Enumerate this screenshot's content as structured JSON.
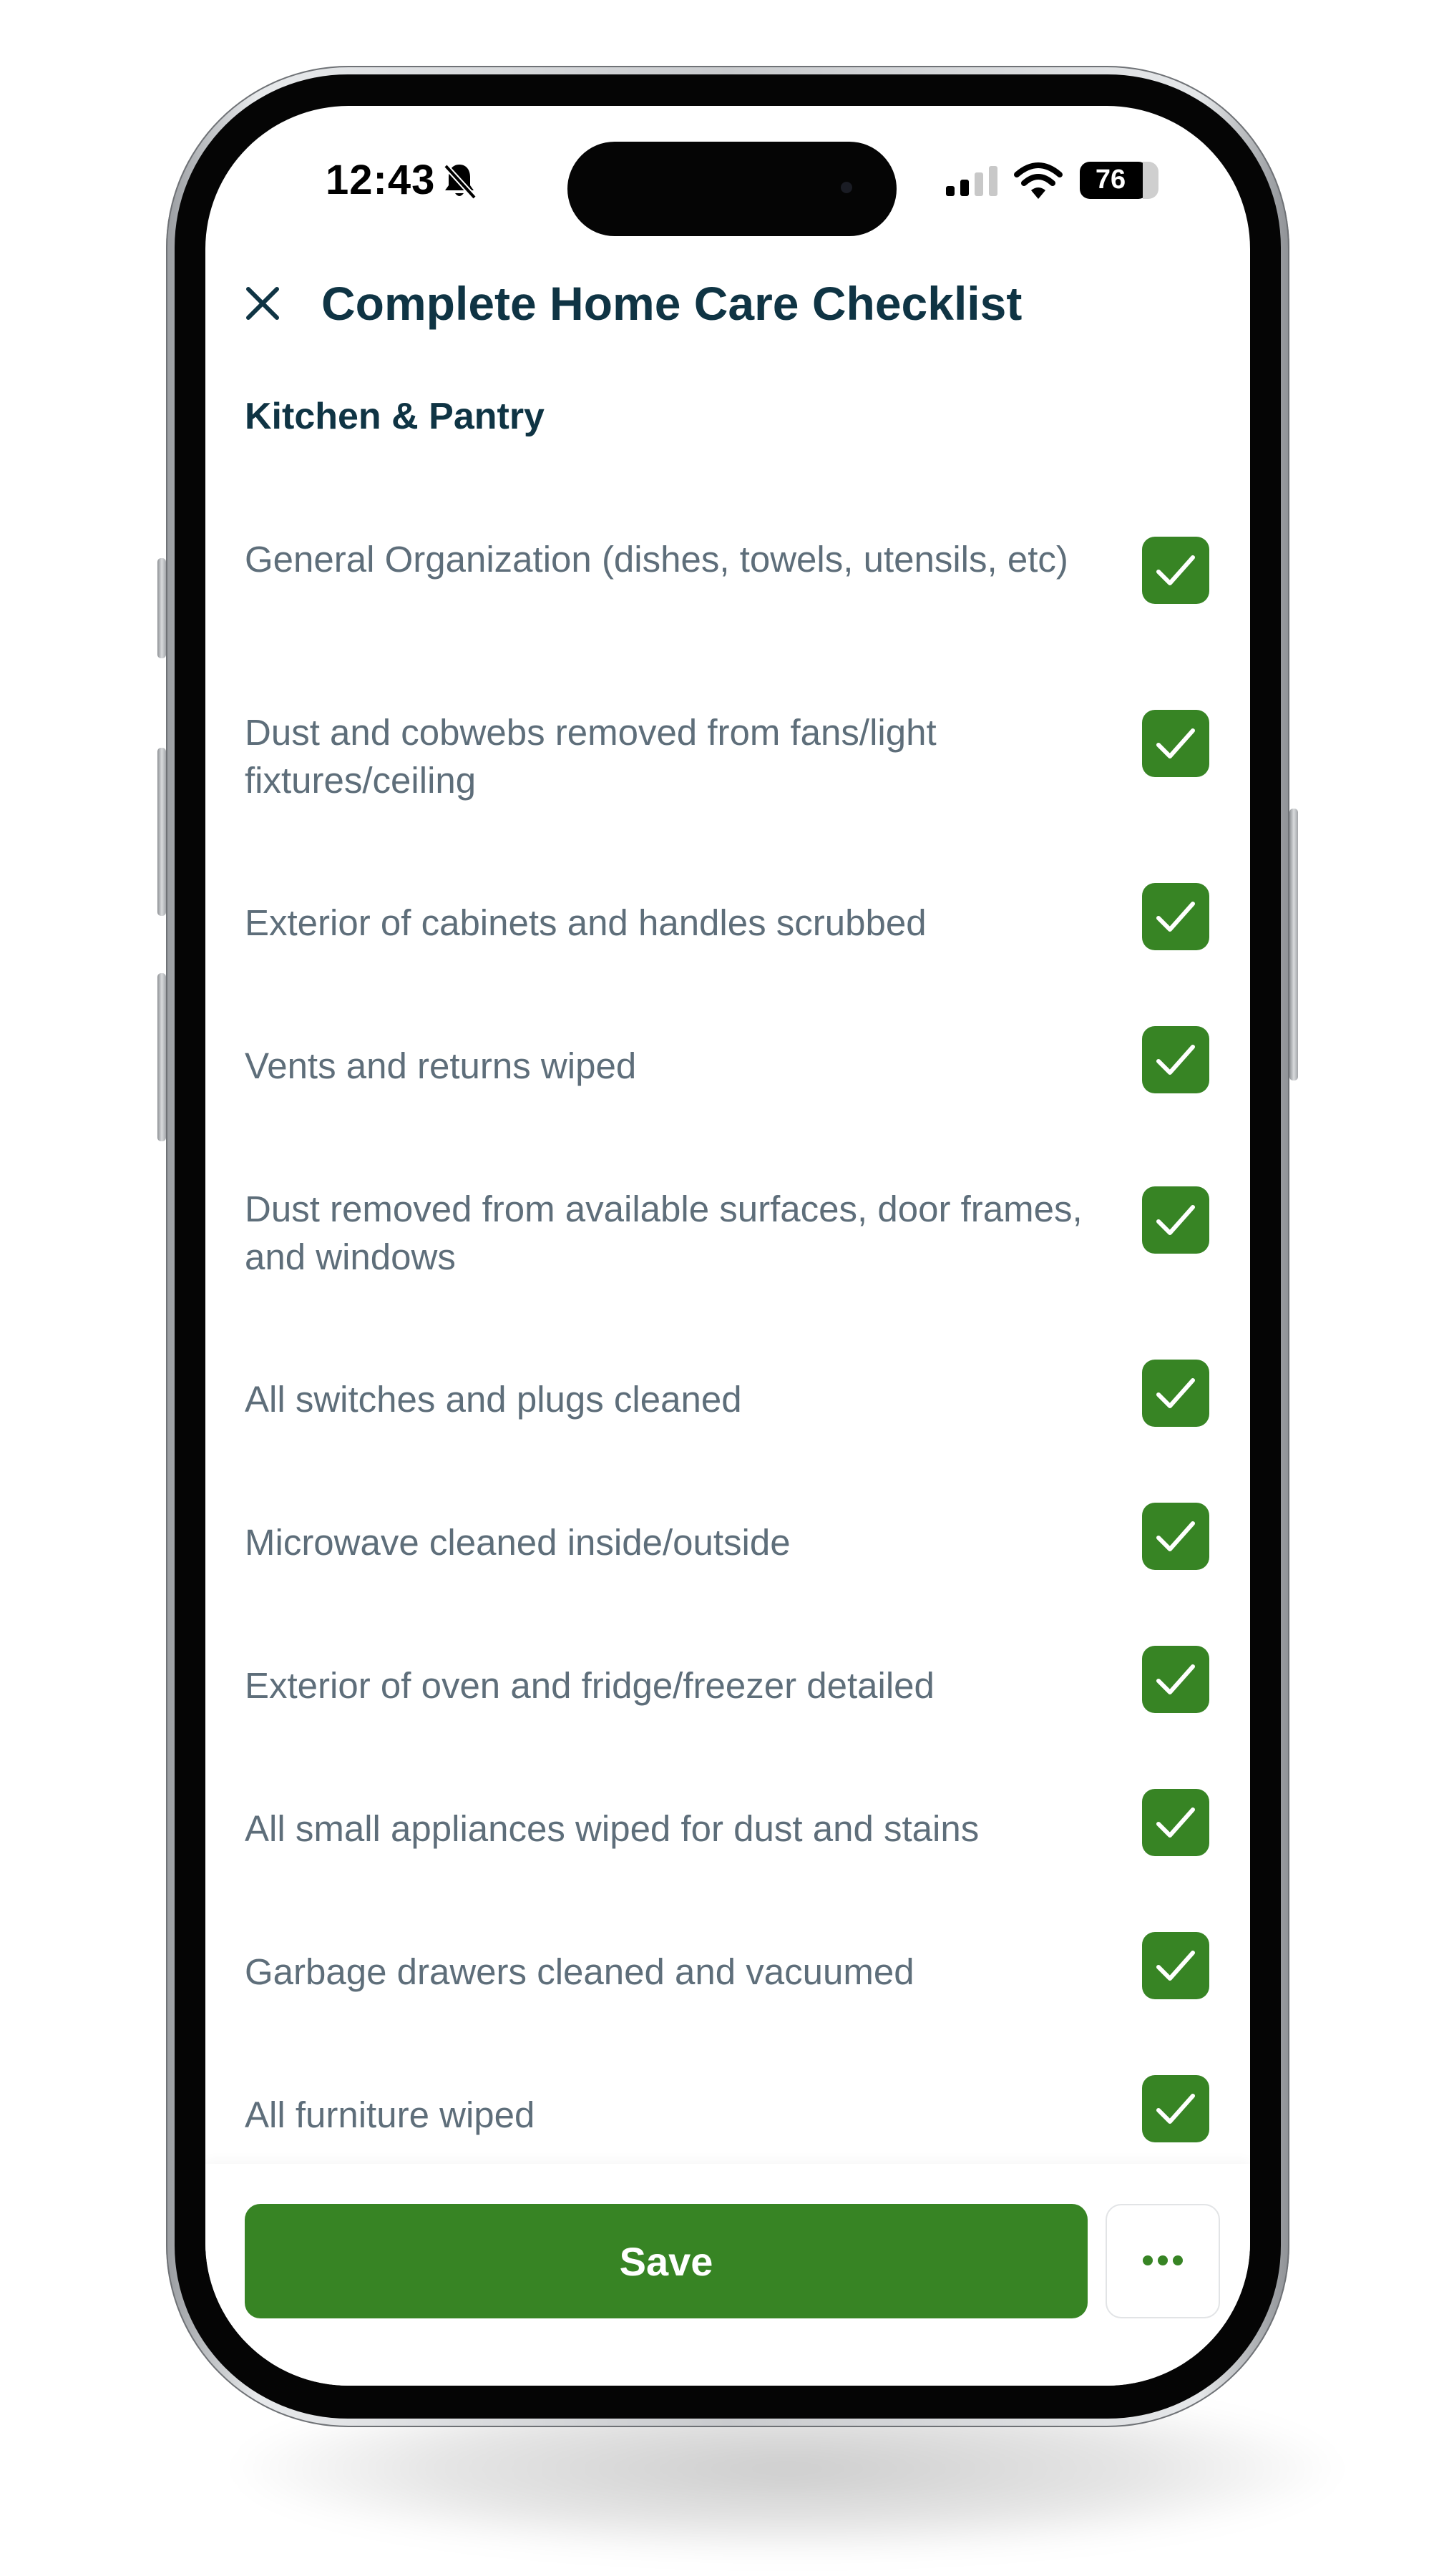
{
  "status_bar": {
    "time": "12:43",
    "battery": "76",
    "icons": [
      "bell-slash-icon",
      "cellular-signal-icon",
      "wifi-icon",
      "battery-icon"
    ]
  },
  "header": {
    "close_icon": "close-icon",
    "title": "Complete Home Care Checklist"
  },
  "section": {
    "title": "Kitchen & Pantry"
  },
  "checklist": {
    "items": [
      {
        "label": "General Organization (dishes, towels, utensils, etc)",
        "checked": true
      },
      {
        "label": "Dust and cobwebs removed from fans/light fixtures/ceiling",
        "checked": true
      },
      {
        "label": "Exterior of cabinets and handles scrubbed",
        "checked": true
      },
      {
        "label": "Vents and returns wiped",
        "checked": true
      },
      {
        "label": "Dust removed from available surfaces, door frames, and windows",
        "checked": true
      },
      {
        "label": "All switches and plugs cleaned",
        "checked": true
      },
      {
        "label": "Microwave cleaned inside/outside",
        "checked": true
      },
      {
        "label": "Exterior of oven and fridge/freezer detailed",
        "checked": true
      },
      {
        "label": "All small appliances wiped for dust and stains",
        "checked": true
      },
      {
        "label": "Garbage drawers cleaned and vacuumed",
        "checked": true
      },
      {
        "label": "All furniture wiped",
        "checked": true
      }
    ]
  },
  "footer": {
    "save_label": "Save",
    "more_icon": "more-horizontal-icon"
  },
  "colors": {
    "accent": "#378424",
    "title": "#0f3444",
    "item_text": "#5e6e7a"
  }
}
